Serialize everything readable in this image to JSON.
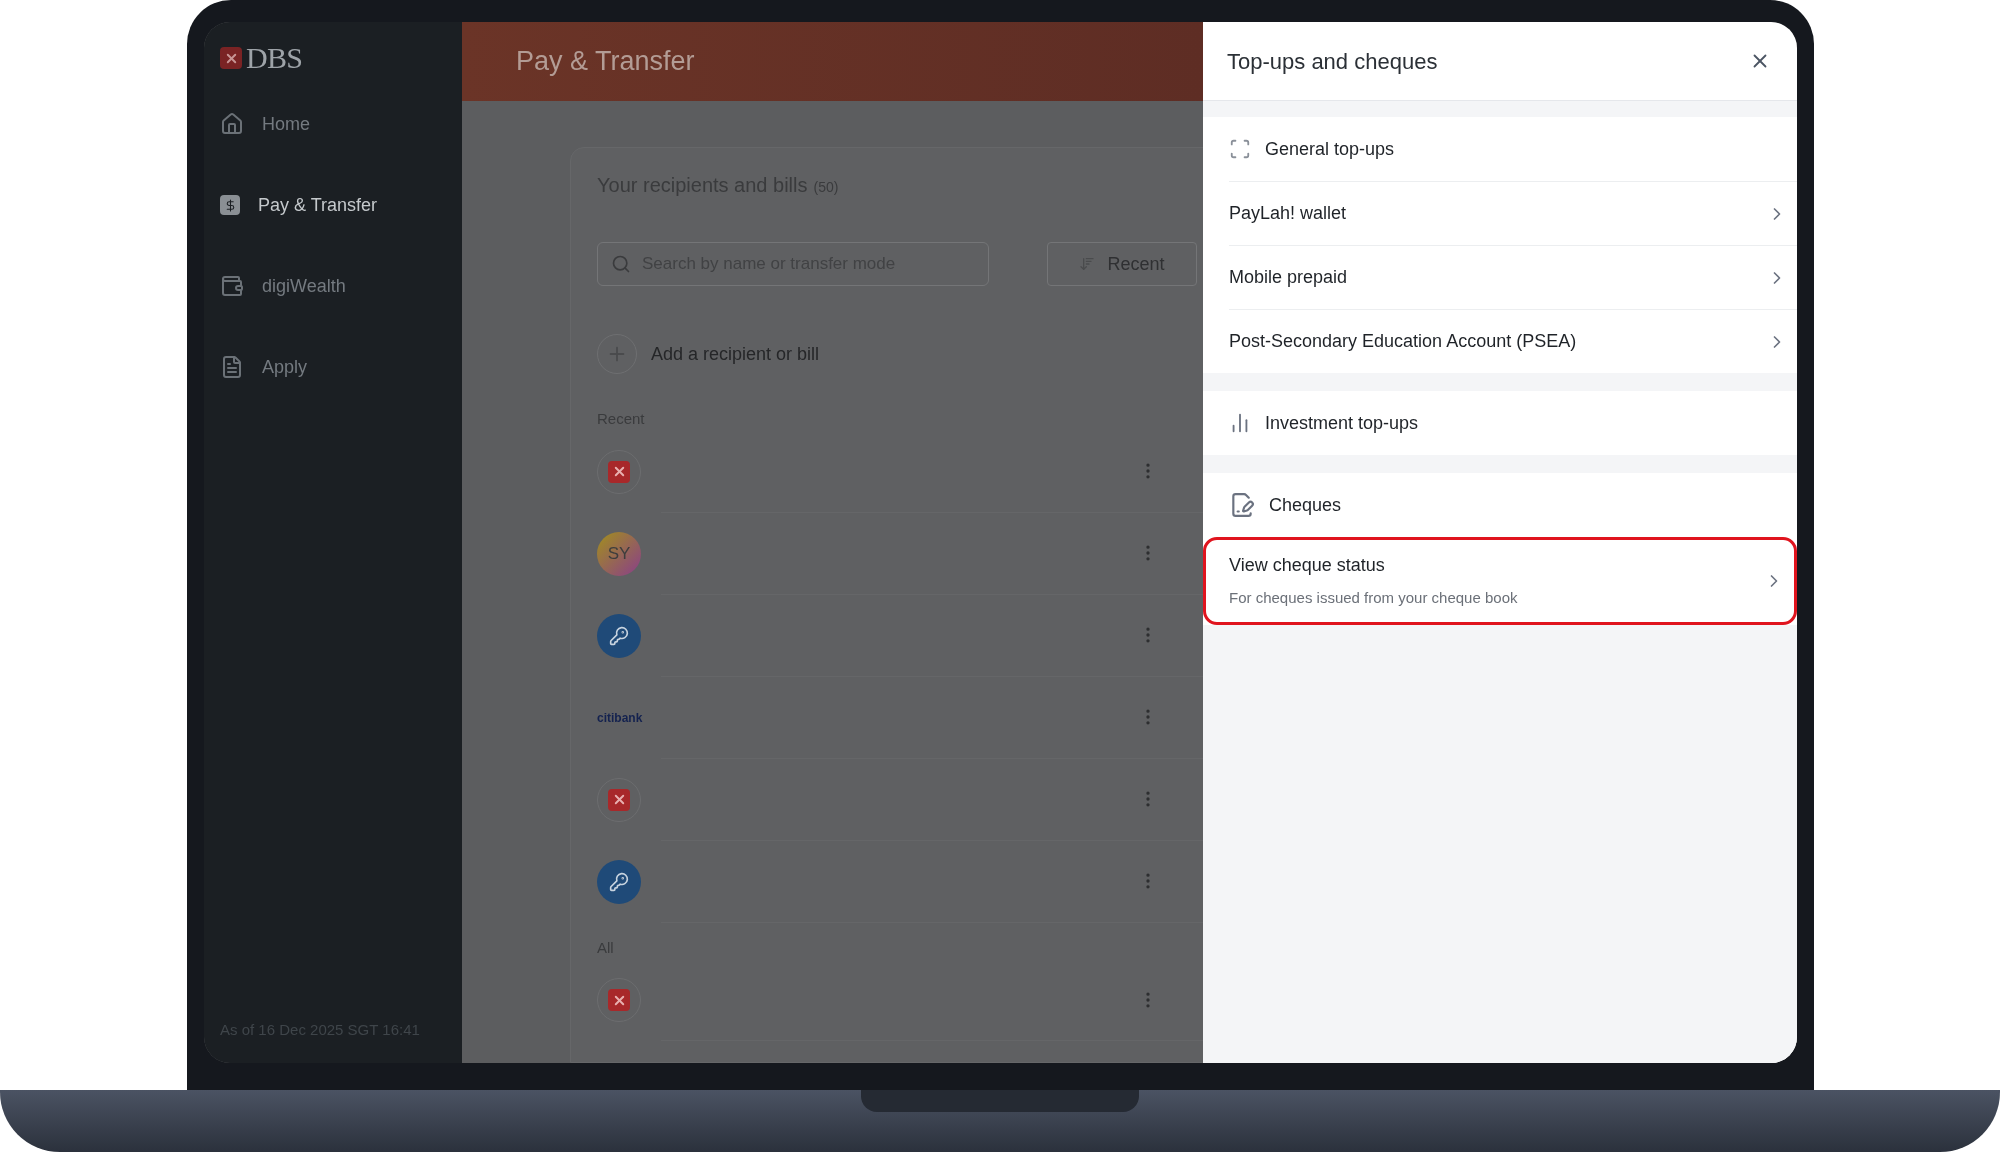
{
  "sidebar": {
    "logo": "DBS",
    "items": [
      {
        "label": "Home",
        "selected": false
      },
      {
        "label": "Pay & Transfer",
        "selected": true
      },
      {
        "label": "digiWealth",
        "selected": false
      },
      {
        "label": "Apply",
        "selected": false
      }
    ],
    "footer": "As of 16 Dec 2025 SGT 16:41"
  },
  "header": {
    "title": "Pay & Transfer"
  },
  "recipients": {
    "title": "Your recipients and bills",
    "count": "(50)",
    "search": {
      "placeholder": "Search by name or transfer mode"
    },
    "sort_button": "Recent",
    "add_label": "Add a recipient or bill",
    "groups": [
      {
        "label": "Recent",
        "items": [
          {
            "kind": "dbs"
          },
          {
            "kind": "initials",
            "text": "SY"
          },
          {
            "kind": "key"
          },
          {
            "kind": "logo",
            "text": "citibank"
          },
          {
            "kind": "dbs"
          },
          {
            "kind": "key"
          }
        ]
      },
      {
        "label": "All",
        "items": [
          {
            "kind": "dbs"
          }
        ]
      }
    ]
  },
  "drawer": {
    "title": "Top-ups and cheques",
    "sections": [
      {
        "title": "General top-ups",
        "items": [
          {
            "label": "PayLah! wallet",
            "highlighted": false
          },
          {
            "label": "Mobile prepaid",
            "highlighted": false
          },
          {
            "label": "Post-Secondary Education Account (PSEA)",
            "highlighted": false
          }
        ]
      },
      {
        "title": "Investment top-ups"
      },
      {
        "title": "Cheques",
        "items": [
          {
            "label": "View cheque status",
            "description": "For cheques issued from your cheque book",
            "highlighted": true
          }
        ]
      }
    ]
  }
}
